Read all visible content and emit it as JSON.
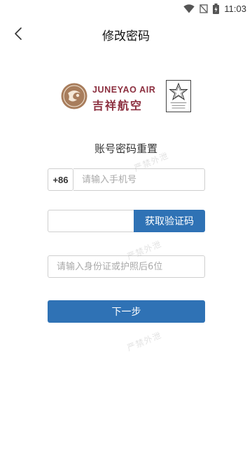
{
  "status_bar": {
    "time": "11:03",
    "icons": [
      "wifi-icon",
      "no-signal-icon",
      "battery-charging-icon"
    ]
  },
  "nav": {
    "title": "修改密码",
    "back_icon": "chevron-left-icon"
  },
  "branding": {
    "brand_en": "JUNEYAO AIR",
    "brand_cn": "吉祥航空",
    "brand_color": "#8c2f3f"
  },
  "form": {
    "section_title": "账号密码重置",
    "country_code": "+86",
    "phone_placeholder": "请输入手机号",
    "phone_value": "",
    "verification_code_value": "",
    "get_code_label": "获取验证码",
    "id_placeholder": "请输入身份证或护照后6位",
    "id_value": "",
    "next_label": "下一步"
  },
  "watermark_text": "严禁外泄",
  "colors": {
    "primary": "#2f72b5",
    "input_border": "#cfcfcf",
    "placeholder": "#a9a9a9"
  }
}
